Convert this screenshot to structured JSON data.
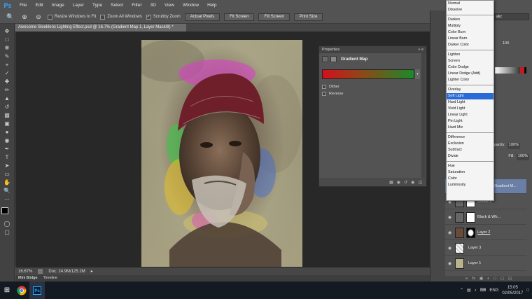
{
  "menubar": {
    "logo": "Ps",
    "items": [
      "File",
      "Edit",
      "Image",
      "Layer",
      "Type",
      "Select",
      "Filter",
      "3D",
      "View",
      "Window",
      "Help"
    ]
  },
  "options": {
    "resize_label": "Resize Windows to Fit",
    "zoom_all_label": "Zoom All Windows",
    "scrubby_label": "Scrubby Zoom",
    "actual_pixels": "Actual Pixels",
    "fit_screen": "Fit Screen",
    "fill_screen": "Fill Screen",
    "print_size": "Print Size"
  },
  "document": {
    "tab_title": "Awesome Sleeklens Lighting Effect.psd @ 16.7% (Gradient Map 1, Layer Mask/8) *",
    "zoom": "16.67%",
    "doc_info": "Doc: 24.9M/125.2M"
  },
  "bottom_tabs": [
    "Mini Bridge",
    "Timeline"
  ],
  "properties": {
    "panel_label": "Properties",
    "title": "Gradient Map",
    "dither_label": "Dither",
    "reverse_label": "Reverse",
    "gradient_colors": [
      "#d40f1d",
      "#1a8a2a"
    ]
  },
  "blend_modes": {
    "groups": [
      [
        "Normal",
        "Dissolve"
      ],
      [
        "Darken",
        "Multiply",
        "Color Burn",
        "Linear Burn",
        "Darker Color"
      ],
      [
        "Lighten",
        "Screen",
        "Color Dodge",
        "Linear Dodge (Add)",
        "Lighter Color"
      ],
      [
        "Overlay",
        "Soft Light",
        "Hard Light",
        "Vivid Light",
        "Linear Light",
        "Pin Light",
        "Hard Mix"
      ],
      [
        "Difference",
        "Exclusion",
        "Subtract",
        "Divide"
      ],
      [
        "Hue",
        "Saturation",
        "Color",
        "Luminosity"
      ]
    ],
    "selected": "Soft Light"
  },
  "right_panel": {
    "font_partial": "alic",
    "zoom_value": "100",
    "opacity_label": "pacity:",
    "opacity_value": "100%",
    "fill_label": "Fill:",
    "fill_value": "100%"
  },
  "layers": [
    {
      "name": "Gradient M...",
      "type": "adjustment"
    },
    {
      "name": "Levels 1",
      "type": "adjustment"
    },
    {
      "name": "Black & Wh...",
      "type": "adjustment"
    },
    {
      "name": "Layer 2",
      "type": "pixel"
    },
    {
      "name": "Layer 3",
      "type": "pixel"
    },
    {
      "name": "Layer 1",
      "type": "pixel"
    }
  ],
  "taskbar": {
    "language": "ENG",
    "time": "15:05",
    "date": "02/05/2017",
    "ps_label": "Ps"
  }
}
